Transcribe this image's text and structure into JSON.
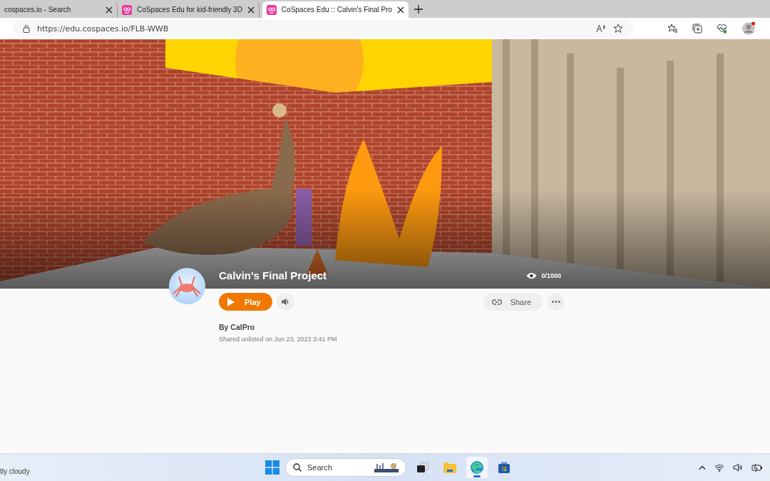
{
  "browser": {
    "tabs": [
      {
        "title": "cospaces.io - Search",
        "kind": "search",
        "selected": false
      },
      {
        "title": "CoSpaces Edu for kid-friendly 3D",
        "kind": "site",
        "selected": false
      },
      {
        "title": "CoSpaces Edu :: Calvin's Final Pro",
        "kind": "site",
        "selected": true
      }
    ],
    "url": "https://edu.cospaces.io/FLB-WWB"
  },
  "space": {
    "title": "Calvin's Final Project",
    "views": "0/1000",
    "play": "Play",
    "share": "Share",
    "author": "By CalPro",
    "shared": "Shared unlisted on Jun 23, 2023 3:41 PM"
  },
  "taskbar": {
    "weather": "tly cloudy",
    "search_placeholder": "Search",
    "apps": [
      {
        "kind": "task-view",
        "active": false
      },
      {
        "kind": "folder",
        "active": false
      },
      {
        "kind": "browser",
        "active": true
      },
      {
        "kind": "store",
        "active": false
      }
    ]
  }
}
